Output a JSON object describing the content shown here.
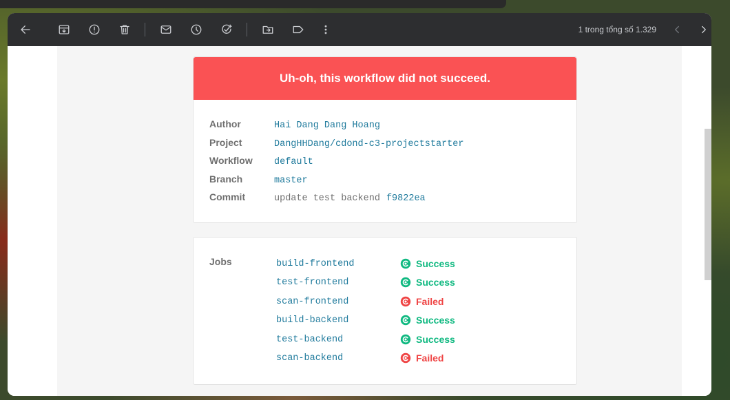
{
  "toolbar": {
    "back": "arrow-left-icon",
    "archive": "archive-icon",
    "spam": "report-icon",
    "delete": "trash-icon",
    "unread": "mail-icon",
    "snooze": "clock-icon",
    "task": "add-task-icon",
    "move": "move-to-icon",
    "label": "label-icon",
    "more": "more-vert-icon",
    "count": "1 trong tổng số 1.329",
    "prev": "chevron-left-icon",
    "next": "chevron-right-icon"
  },
  "email": {
    "banner": "Uh-oh, this workflow did not succeed.",
    "colors": {
      "banner": "#fa5254",
      "success": "#10b981",
      "failed": "#ef4444",
      "link": "#1f7a9c"
    },
    "meta": [
      {
        "label": "Author",
        "value": "Hai Dang Dang Hoang"
      },
      {
        "label": "Project",
        "value": "DangHHDang/cdond-c3-projectstarter"
      },
      {
        "label": "Workflow",
        "value": "default"
      },
      {
        "label": "Branch",
        "value": "master"
      },
      {
        "label": "Commit",
        "value": "update test backend",
        "hash": "f9822ea"
      }
    ],
    "jobs_label": "Jobs",
    "jobs": [
      {
        "name": "build-frontend",
        "status": "Success"
      },
      {
        "name": "test-frontend",
        "status": "Success"
      },
      {
        "name": "scan-frontend",
        "status": "Failed"
      },
      {
        "name": "build-backend",
        "status": "Success"
      },
      {
        "name": "test-backend",
        "status": "Success"
      },
      {
        "name": "scan-backend",
        "status": "Failed"
      }
    ]
  }
}
